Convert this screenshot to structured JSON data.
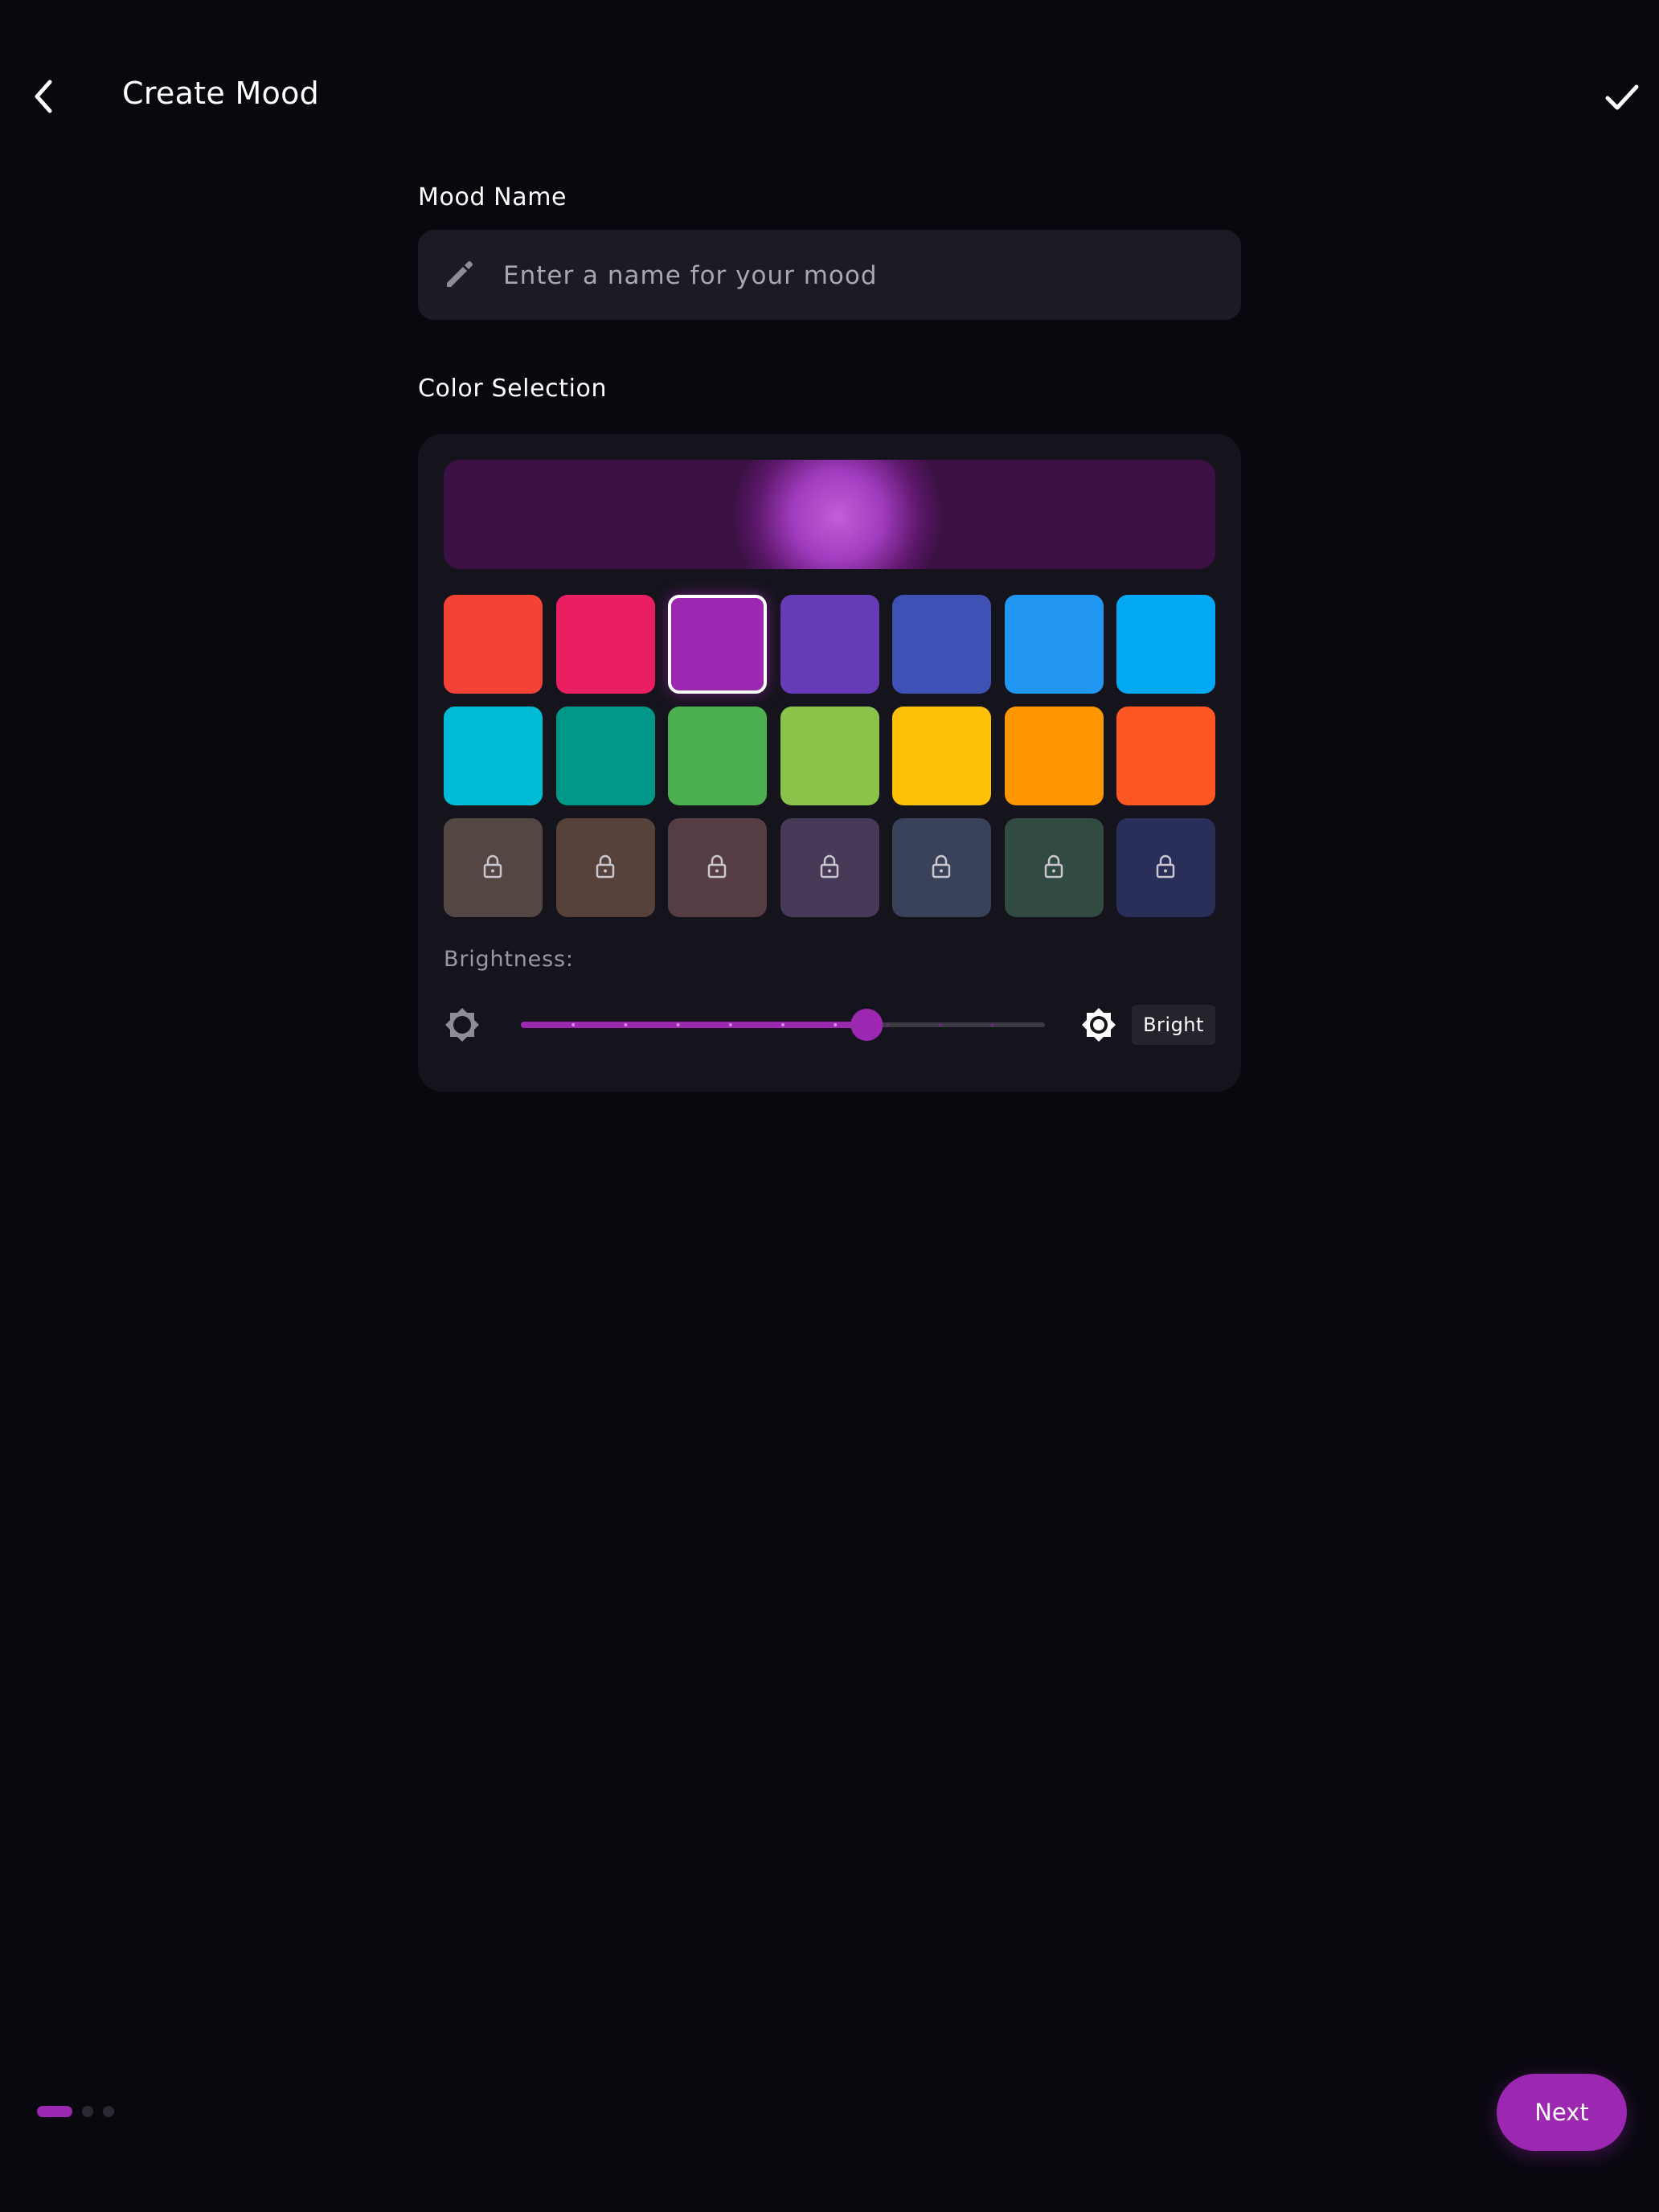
{
  "header": {
    "title": "Create Mood"
  },
  "mood_name": {
    "label": "Mood Name",
    "value": "",
    "placeholder": "Enter a name for your mood"
  },
  "color_selection": {
    "label": "Color Selection",
    "preview_color": "#9c27b0",
    "selected_index": 2,
    "swatches": [
      {
        "color": "#f44336",
        "locked": false
      },
      {
        "color": "#e91e63",
        "locked": false
      },
      {
        "color": "#9c27b0",
        "locked": false
      },
      {
        "color": "#673ab7",
        "locked": false
      },
      {
        "color": "#3f51b5",
        "locked": false
      },
      {
        "color": "#2196f3",
        "locked": false
      },
      {
        "color": "#03a9f4",
        "locked": false
      },
      {
        "color": "#00bcd4",
        "locked": false
      },
      {
        "color": "#009688",
        "locked": false
      },
      {
        "color": "#4caf50",
        "locked": false
      },
      {
        "color": "#8bc34a",
        "locked": false
      },
      {
        "color": "#ffc107",
        "locked": false
      },
      {
        "color": "#ff9800",
        "locked": false
      },
      {
        "color": "#ff5722",
        "locked": false
      },
      {
        "color": "#544643",
        "locked": true
      },
      {
        "color": "#56423a",
        "locked": true
      },
      {
        "color": "#563d43",
        "locked": true
      },
      {
        "color": "#473a58",
        "locked": true
      },
      {
        "color": "#394259",
        "locked": true
      },
      {
        "color": "#314a42",
        "locked": true
      },
      {
        "color": "#2a2f5a",
        "locked": true
      }
    ]
  },
  "brightness": {
    "label": "Brightness:",
    "value": 0.66,
    "steps": 10,
    "level_text": "Bright"
  },
  "pagination": {
    "total": 3,
    "current": 1
  },
  "next_button": {
    "label": "Next"
  },
  "colors": {
    "accent": "#9c27b0",
    "background": "#09080f",
    "card": "#15141c",
    "field": "#1c1b25"
  }
}
